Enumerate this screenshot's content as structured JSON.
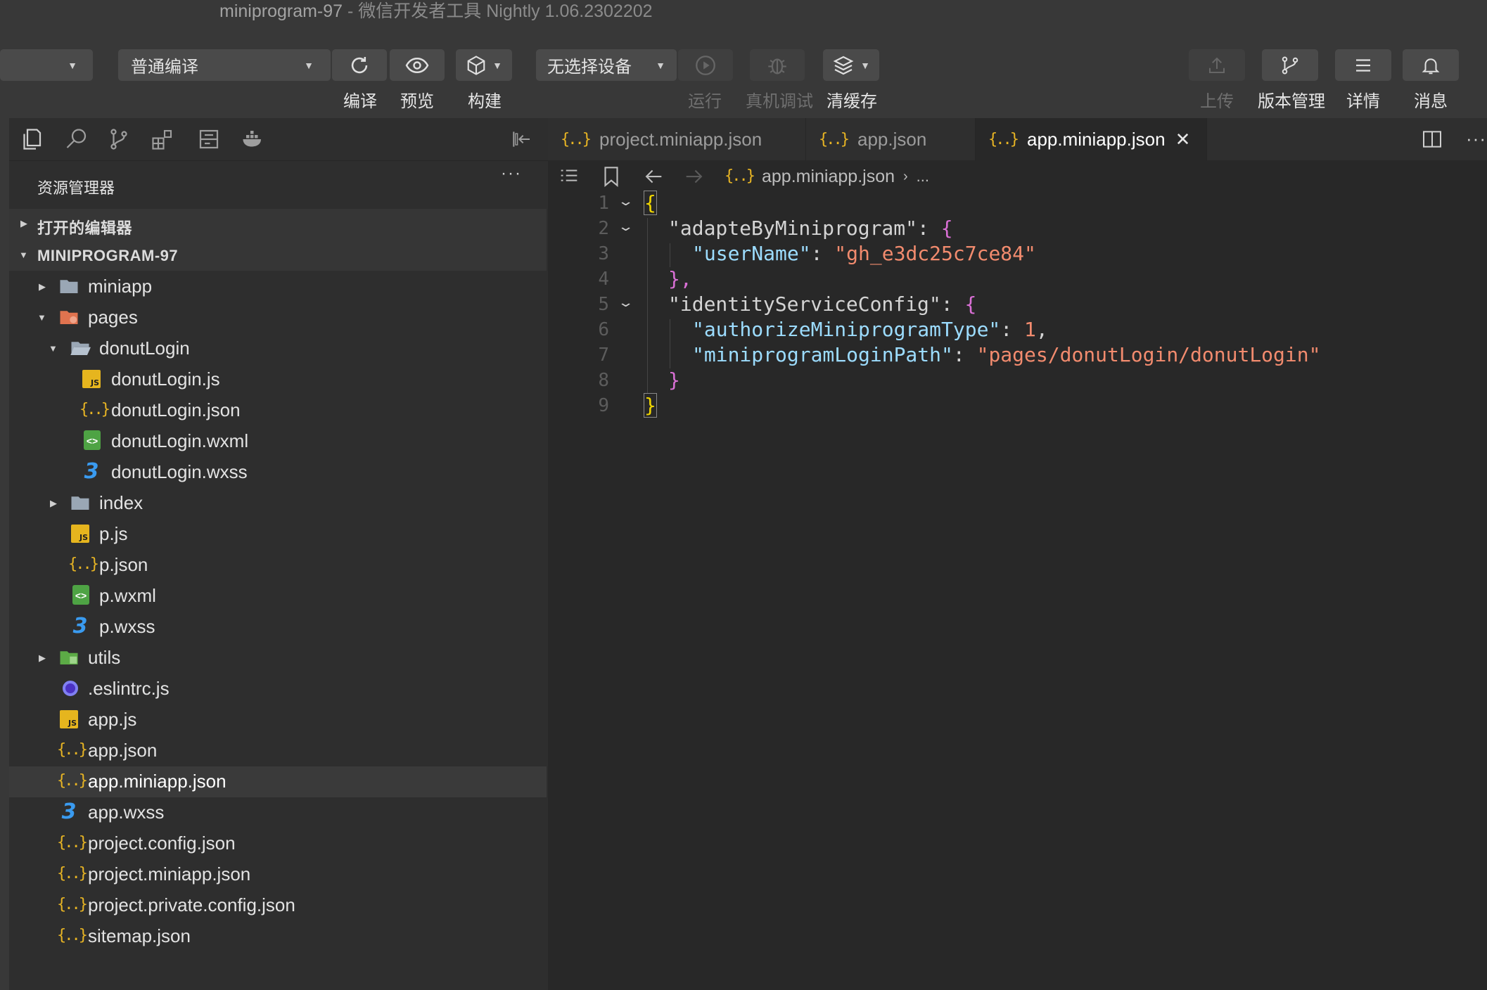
{
  "window": {
    "project_name": "miniprogram-97",
    "app_title": "- 微信开发者工具 Nightly 1.06.2302202"
  },
  "toolbar": {
    "compile_mode": "普通编译",
    "device": "无选择设备",
    "buttons": {
      "compile": "编译",
      "preview": "预览",
      "build": "构建",
      "run": "运行",
      "device_debug": "真机调试",
      "clear_cache": "清缓存",
      "upload": "上传",
      "version_manage": "版本管理",
      "details": "详情",
      "messages": "消息"
    }
  },
  "sidebar": {
    "title": "资源管理器",
    "more": "···",
    "open_editors": "打开的编辑器",
    "project_root": "MINIPROGRAM-97",
    "tree": [
      {
        "label": "miniapp"
      },
      {
        "label": "pages"
      },
      {
        "label": "donutLogin"
      },
      {
        "label": "donutLogin.js"
      },
      {
        "label": "donutLogin.json"
      },
      {
        "label": "donutLogin.wxml"
      },
      {
        "label": "donutLogin.wxss"
      },
      {
        "label": "index"
      },
      {
        "label": "p.js"
      },
      {
        "label": "p.json"
      },
      {
        "label": "p.wxml"
      },
      {
        "label": "p.wxss"
      },
      {
        "label": "utils"
      },
      {
        "label": ".eslintrc.js"
      },
      {
        "label": "app.js"
      },
      {
        "label": "app.json"
      },
      {
        "label": "app.miniapp.json"
      },
      {
        "label": "app.wxss"
      },
      {
        "label": "project.config.json"
      },
      {
        "label": "project.miniapp.json"
      },
      {
        "label": "project.private.config.json"
      },
      {
        "label": "sitemap.json"
      }
    ]
  },
  "tabs": [
    {
      "label": "project.miniapp.json"
    },
    {
      "label": "app.json"
    },
    {
      "label": "app.miniapp.json",
      "active": true
    }
  ],
  "breadcrumbs": {
    "file": "app.miniapp.json",
    "tail": "..."
  },
  "editor": {
    "line_numbers": [
      "1",
      "2",
      "3",
      "4",
      "5",
      "6",
      "7",
      "8",
      "9"
    ],
    "code": {
      "l1_brace": "{",
      "l2_key": "\"adapteByMiniprogram\"",
      "l2_colon": ": ",
      "l2_brace": "{",
      "l3_key": "\"userName\"",
      "l3_colon": ": ",
      "l3_value": "\"gh_e3dc25c7ce84\"",
      "l4_close": "},",
      "l5_key": "\"identityServiceConfig\"",
      "l5_colon": ": ",
      "l5_brace": "{",
      "l6_key": "\"authorizeMiniprogramType\"",
      "l6_colon": ": ",
      "l6_value": "1",
      "l6_comma": ",",
      "l7_key": "\"miniprogramLoginPath\"",
      "l7_colon": ": ",
      "l7_value": "\"pages/donutLogin/donutLogin\"",
      "l8_close": "}",
      "l9_brace": "}"
    }
  }
}
